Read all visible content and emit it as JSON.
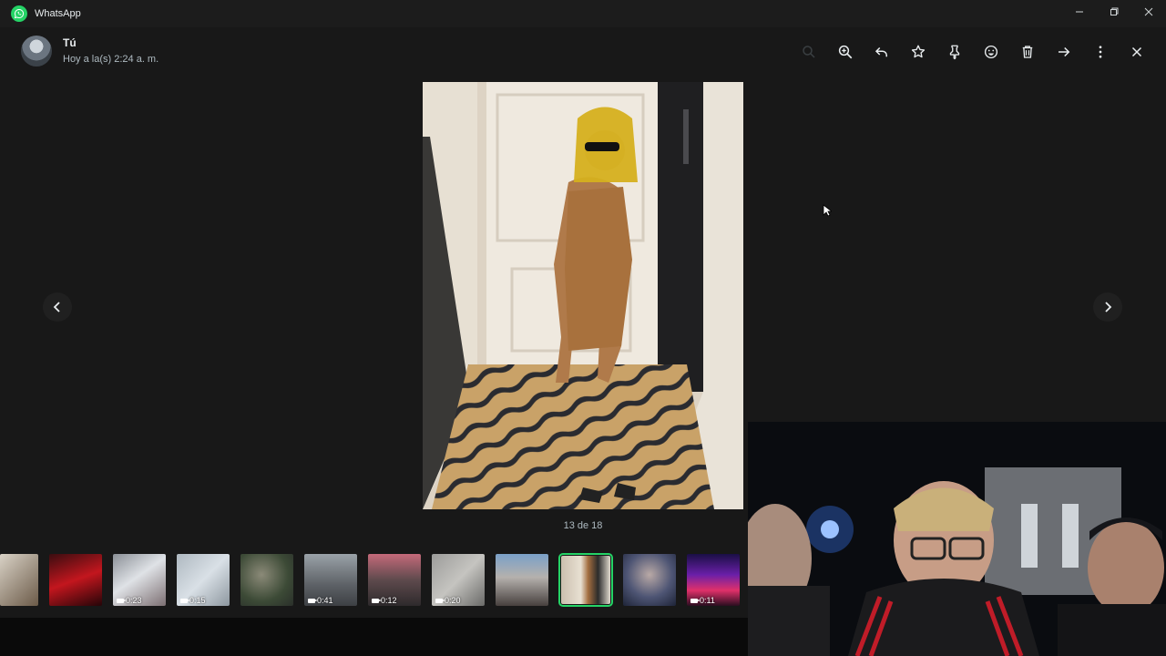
{
  "app": {
    "title": "WhatsApp"
  },
  "window_controls": [
    "minimize",
    "restore",
    "close"
  ],
  "header": {
    "sender": "Tú",
    "timestamp": "Hoy a la(s) 2:24 a. m."
  },
  "toolbar": [
    {
      "name": "search-icon",
      "enabled": false
    },
    {
      "name": "zoom-in-icon",
      "enabled": true
    },
    {
      "name": "reply-icon",
      "enabled": true
    },
    {
      "name": "star-icon",
      "enabled": true
    },
    {
      "name": "pin-icon",
      "enabled": true
    },
    {
      "name": "emoji-icon",
      "enabled": true
    },
    {
      "name": "trash-icon",
      "enabled": true
    },
    {
      "name": "forward-icon",
      "enabled": true
    },
    {
      "name": "more-icon",
      "enabled": true
    },
    {
      "name": "close-icon",
      "enabled": true
    }
  ],
  "viewer": {
    "counter": "13 de 18",
    "image_description": "person in gold sequin dress and gold tinsel wig in hallway"
  },
  "thumbnails": [
    {
      "type": "image",
      "duration": ""
    },
    {
      "type": "image",
      "duration": ""
    },
    {
      "type": "video",
      "duration": "0:23"
    },
    {
      "type": "video",
      "duration": "0:15"
    },
    {
      "type": "image",
      "duration": ""
    },
    {
      "type": "video",
      "duration": "0:41"
    },
    {
      "type": "video",
      "duration": "0:12"
    },
    {
      "type": "video",
      "duration": "0:20"
    },
    {
      "type": "image",
      "duration": ""
    },
    {
      "type": "image",
      "duration": "",
      "selected": true
    },
    {
      "type": "image",
      "duration": ""
    },
    {
      "type": "video",
      "duration": "0:11"
    }
  ],
  "colors": {
    "background": "#181818",
    "accent": "#25d366",
    "text_primary": "#e9edef",
    "text_secondary": "#aebac1"
  }
}
